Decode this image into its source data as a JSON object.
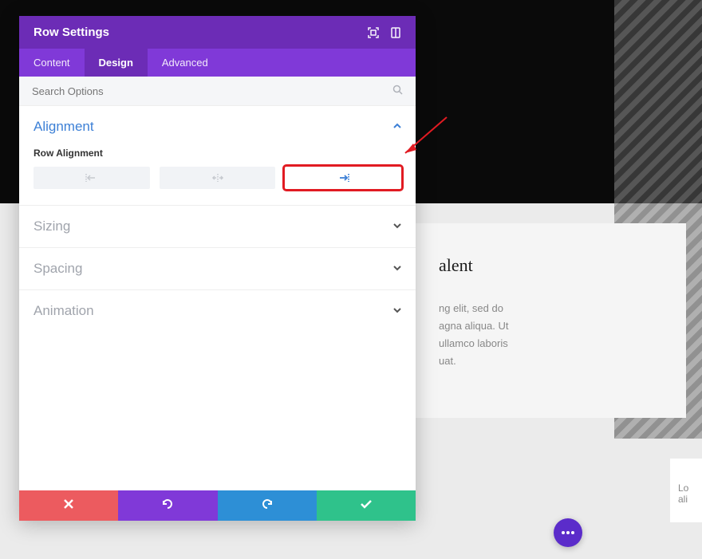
{
  "modal": {
    "title": "Row Settings",
    "tabs": {
      "content": "Content",
      "design": "Design",
      "advanced": "Advanced"
    },
    "search_placeholder": "Search Options"
  },
  "sections": {
    "alignment": {
      "title": "Alignment",
      "field_label": "Row Alignment"
    },
    "sizing": {
      "title": "Sizing"
    },
    "spacing": {
      "title": "Spacing"
    },
    "animation": {
      "title": "Animation"
    }
  },
  "page": {
    "heading_fragment": "alent",
    "body_line1": "ng elit, sed do",
    "body_line2": "agna aliqua. Ut",
    "body_line3": "ullamco laboris",
    "body_line4": "uat.",
    "side_line1": "Lo",
    "side_line2": "ali"
  }
}
